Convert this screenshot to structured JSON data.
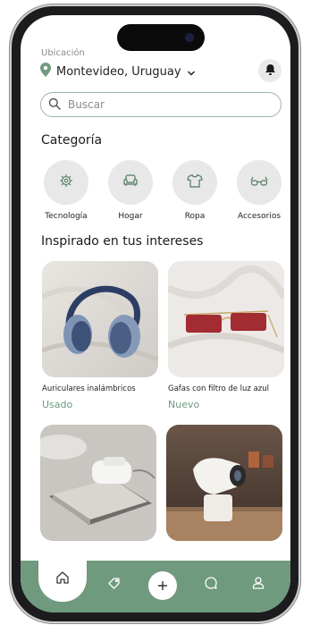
{
  "header": {
    "location_label": "Ubicación",
    "location_value": "Montevideo, Uruguay"
  },
  "search": {
    "placeholder": "Buscar"
  },
  "categories": {
    "title": "Categoría",
    "items": [
      {
        "label": "Tecnología",
        "icon": "chip-icon"
      },
      {
        "label": "Hogar",
        "icon": "armchair-icon"
      },
      {
        "label": "Ropa",
        "icon": "tshirt-icon"
      },
      {
        "label": "Accesorios",
        "icon": "glasses-icon"
      }
    ]
  },
  "interests": {
    "title": "Inspirado en tus intereses",
    "products": [
      {
        "name": "Auriculares inalámbricos",
        "condition": "Usado",
        "image": "headphones-image"
      },
      {
        "name": "Gafas con filtro de luz azul",
        "condition": "Nuevo",
        "image": "sunglasses-image"
      },
      {
        "name": "",
        "condition": "",
        "image": "wireless-charger-image"
      },
      {
        "name": "",
        "condition": "",
        "image": "projector-image"
      }
    ]
  },
  "bottom_nav": {
    "items": [
      "home-icon",
      "tag-icon",
      "add-icon",
      "chat-icon",
      "profile-icon"
    ],
    "active": "home-icon"
  },
  "colors": {
    "accent": "#6f9a7e",
    "accent_text": "#6f9a7e",
    "phone_frame": "#1c1c1e",
    "category_bg": "#e8e8e8"
  }
}
